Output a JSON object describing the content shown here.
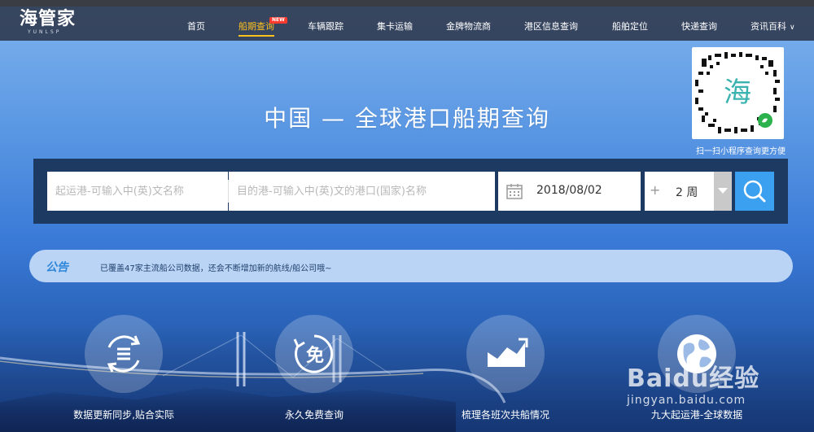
{
  "header": {
    "logo_main": "海管家",
    "logo_sub": "YUNLSP",
    "nav": [
      {
        "label": "首页",
        "active": false
      },
      {
        "label": "船期查询",
        "active": true,
        "badge": "NEW"
      },
      {
        "label": "车辆跟踪",
        "active": false
      },
      {
        "label": "集卡运输",
        "active": false
      },
      {
        "label": "金牌物流商",
        "active": false
      },
      {
        "label": "港区信息查询",
        "active": false
      },
      {
        "label": "船舶定位",
        "active": false
      },
      {
        "label": "快递查询",
        "active": false
      },
      {
        "label": "资讯百科",
        "active": false,
        "dropdown": true
      }
    ]
  },
  "hero": {
    "headline": "中国 — 全球港口船期查询",
    "qr_caption": "扫一扫小程序查询更方便",
    "qr_center": "海"
  },
  "search": {
    "origin_placeholder": "起运港-可输入中(英)文名称",
    "dest_placeholder": "目的港-可输入中(英)文的港口(国家)名称",
    "date_value": "2018/08/02",
    "plus": "+",
    "weeks_value": "2 周"
  },
  "notice": {
    "title": "公告",
    "text": "已覆盖47家主流船公司数据，还会不断增加新的航线/船公司哦~"
  },
  "features": [
    {
      "label": "数据更新同步,贴合实际",
      "icon": "sync-list-icon"
    },
    {
      "label": "永久免费查询",
      "icon": "free-icon",
      "glyph": "免"
    },
    {
      "label": "梳理各班次共船情况",
      "icon": "trend-chart-icon"
    },
    {
      "label": "九大起运港-全球数据",
      "icon": "globe-icon"
    }
  ],
  "watermark": {
    "main": "Baidu经验",
    "sub": "jingyan.baidu.com"
  },
  "colors": {
    "nav_active": "#ffc21d",
    "search_button": "#3aa0ef",
    "notice_title": "#2d86d9",
    "badge": "#ff3b30"
  }
}
